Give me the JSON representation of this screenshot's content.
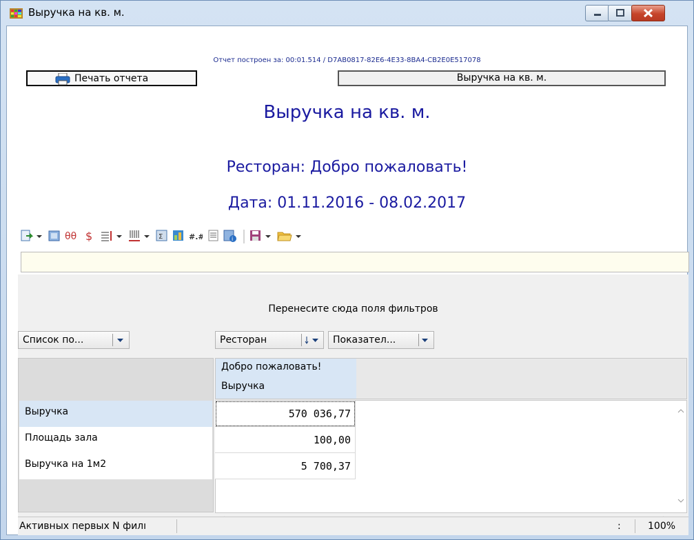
{
  "window": {
    "title": "Выручка на кв. м."
  },
  "report": {
    "info": "Отчет построен за: 00:01.514 / D7AB0817-82E6-4E33-8BA4-CB2E0E517078",
    "print_label": "Печать отчета",
    "report_button_label": "Выручка на кв. м.",
    "title": "Выручка на кв. м.",
    "restaurant_line": "Ресторан: Добро пожаловать!",
    "date_line": "Дата: 01.11.2016 - 08.02.2017"
  },
  "pivot": {
    "filter_hint": "Перенесите сюда поля фильтров",
    "row_field": "Список по...",
    "col_field_1": "Ресторан",
    "col_field_2": "Показател...",
    "column_header": {
      "restaurant": "Добро пожаловать!",
      "measure": "Выручка"
    },
    "rows": [
      {
        "label": "Выручка",
        "value": "570 036,77"
      },
      {
        "label": "Площадь зала",
        "value": "100,00"
      },
      {
        "label": "Выручка на 1м2",
        "value": "5 700,37"
      }
    ]
  },
  "status": {
    "left": "Активных первых N филı",
    "sep": ":",
    "zoom": "100%"
  },
  "colors": {
    "accent_title": "#1a1aa0",
    "selection": "#d8e6f5",
    "filter_strip": "#fefdee"
  }
}
